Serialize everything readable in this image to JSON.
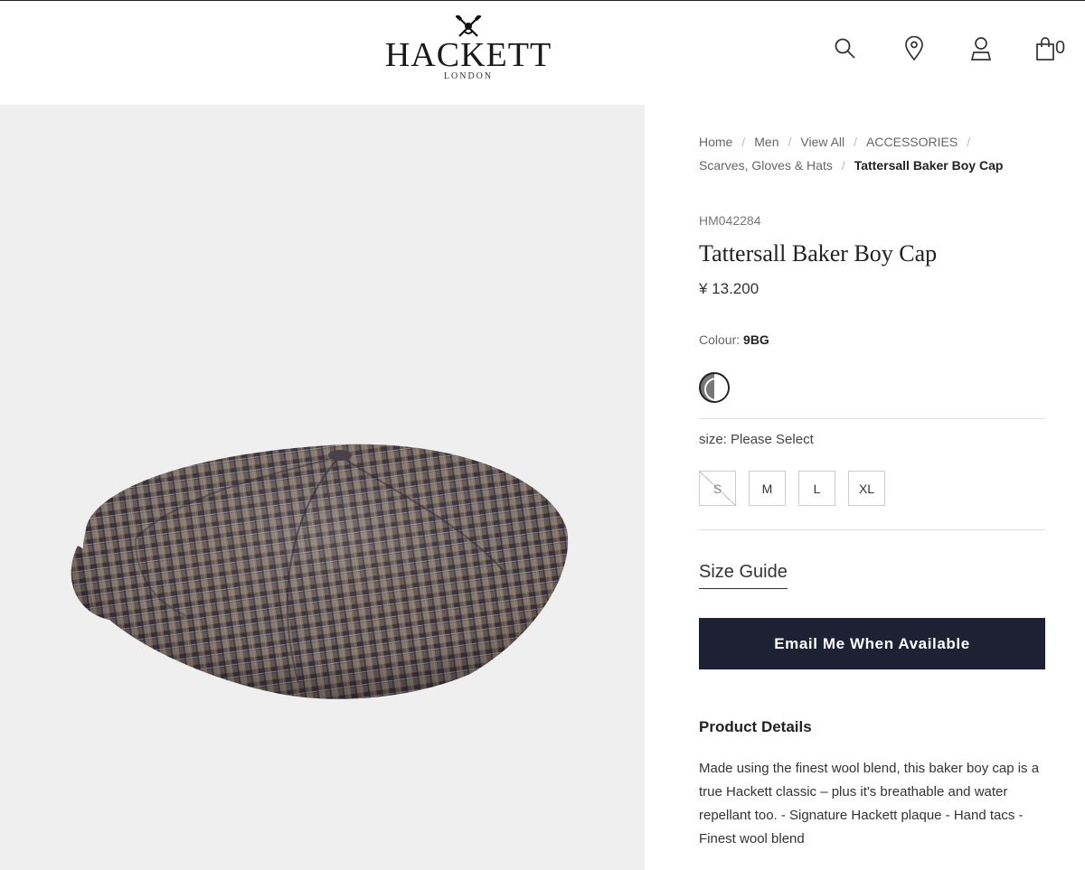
{
  "brand": {
    "name": "HACKETT",
    "subtitle": "LONDON"
  },
  "header": {
    "icons": [
      "search-icon",
      "location-pin-icon",
      "account-icon",
      "shopping-bag-icon"
    ],
    "bag_count": "0"
  },
  "breadcrumb": {
    "items": [
      "Home",
      "Men",
      "View All",
      "ACCESSORIES",
      "Scarves, Gloves & Hats"
    ],
    "current": "Tattersall Baker Boy Cap",
    "separator": "/"
  },
  "product": {
    "sku": "HM042284",
    "title": "Tattersall Baker Boy Cap",
    "price": "¥ 13.200",
    "colour_label": "Colour:",
    "colour_value": "9BG",
    "size_label": "size: Please Select",
    "sizes": [
      {
        "label": "S",
        "available": false
      },
      {
        "label": "M",
        "available": true
      },
      {
        "label": "L",
        "available": true
      },
      {
        "label": "XL",
        "available": true
      }
    ],
    "size_guide": "Size Guide",
    "cta_label": "Email Me When Available",
    "details_title": "Product Details",
    "details_body": "Made using the finest wool blend, this baker boy cap is a true Hackett classic – plus it's breathable and water repellant too. - Signature Hackett plaque - Hand tacs - Finest wool blend"
  },
  "colors": {
    "cta_background": "#1d2133",
    "image_background": "#efefef",
    "cap_brown": "#5a4a42",
    "cap_navy": "#2f3444"
  }
}
